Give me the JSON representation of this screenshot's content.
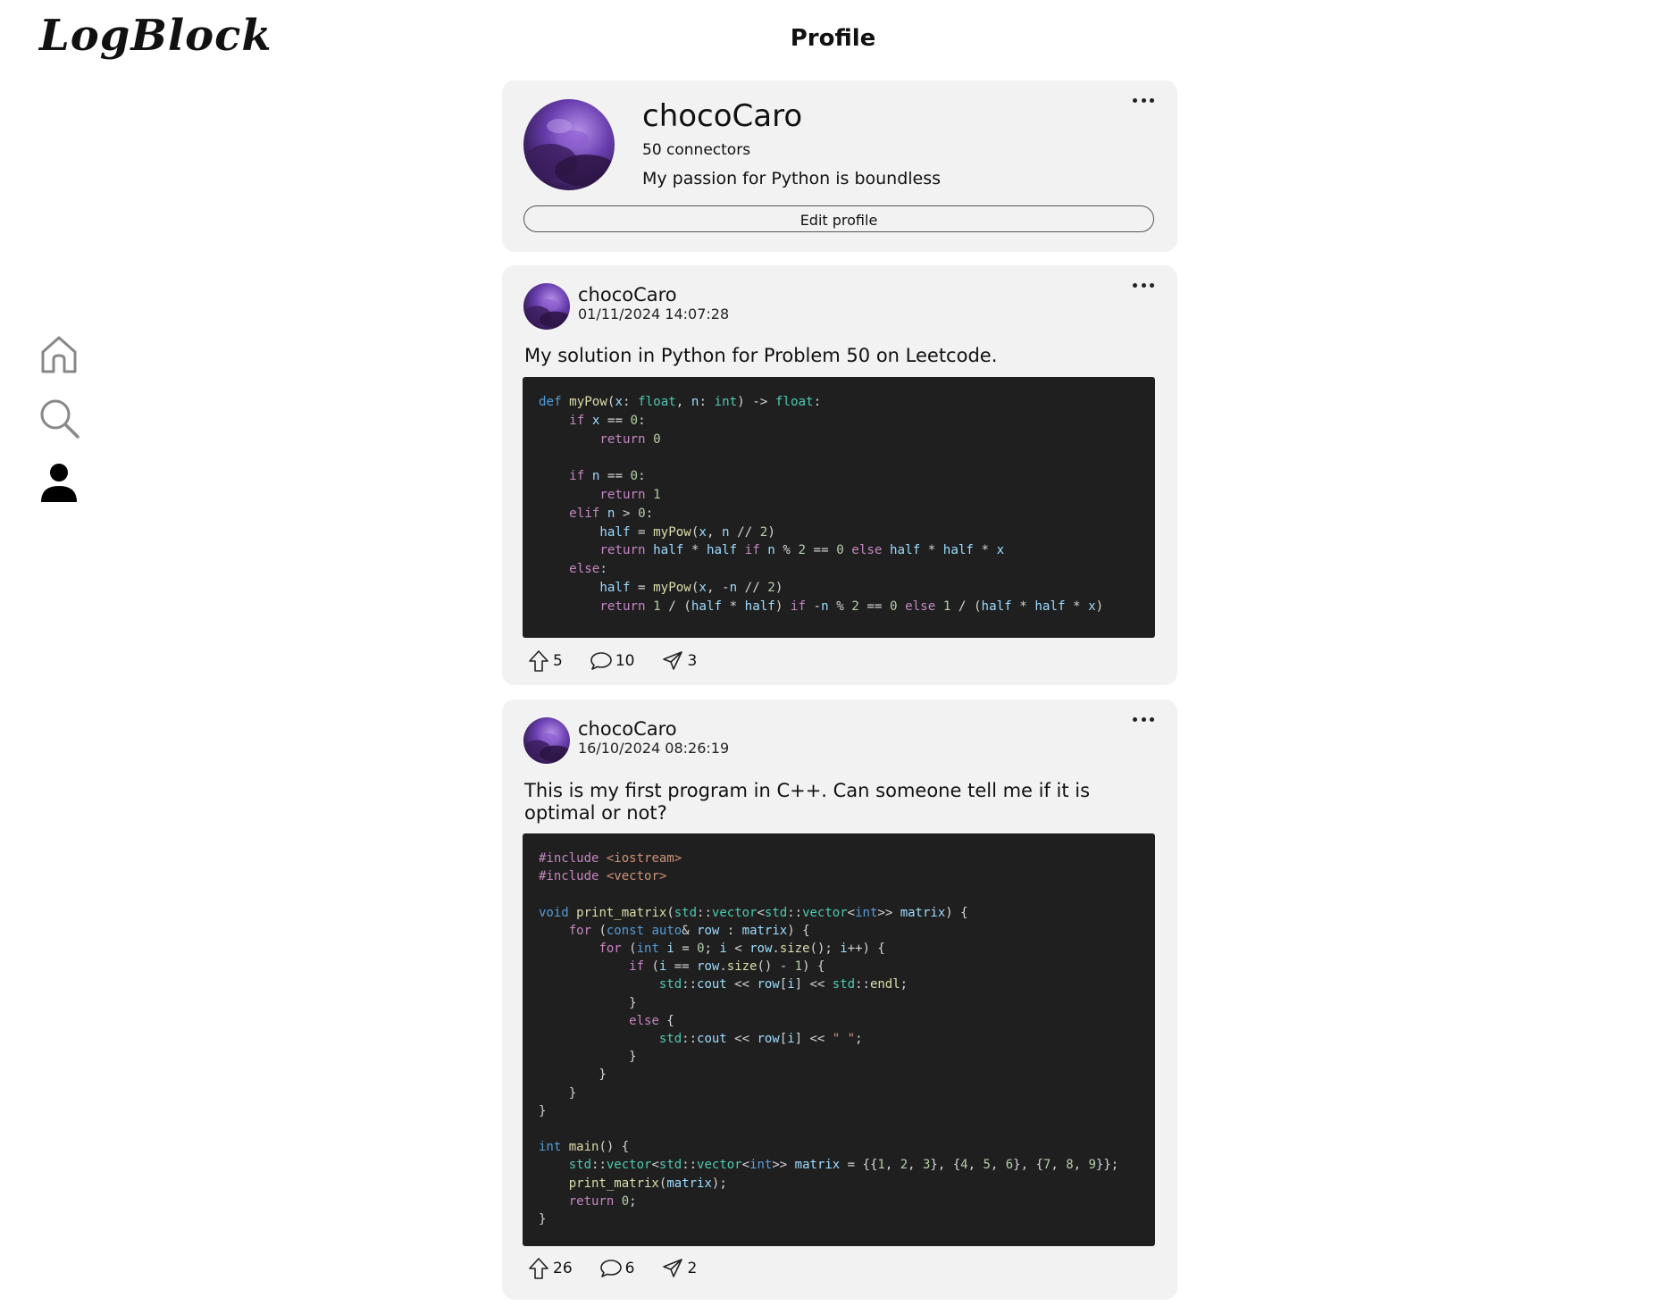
{
  "app": {
    "logo": "LogBlock",
    "page_title": "Profile"
  },
  "nav": [
    {
      "icon": "home-icon",
      "label": "Home"
    },
    {
      "icon": "search-icon",
      "label": "Search"
    },
    {
      "icon": "profile-icon",
      "label": "Profile"
    }
  ],
  "profile": {
    "username": "chocoCaro",
    "connectors": "50 connectors",
    "bio": "My passion for Python is boundless",
    "edit_label": "Edit profile"
  },
  "posts": [
    {
      "author": "chocoCaro",
      "timestamp": "01/11/2024 14:07:28",
      "text": "My solution in Python for Problem 50 on Leetcode.",
      "upvotes": "5",
      "comments": "10",
      "shares": "3"
    },
    {
      "author": "chocoCaro",
      "timestamp": "16/10/2024 08:26:19",
      "text": "This is my first program in C++. Can someone tell me if it is optimal or not?",
      "upvotes": "26",
      "comments": "6",
      "shares": "2"
    }
  ],
  "colors": {
    "card_bg": "#f2f2f2",
    "code_bg": "#1f1f1f",
    "keyword": "#569cd6",
    "control": "#c586c0",
    "function": "#dcdcaa",
    "type": "#4ec9b0",
    "variable": "#9cdcfe",
    "number": "#b5cea8",
    "string": "#ce9178"
  }
}
